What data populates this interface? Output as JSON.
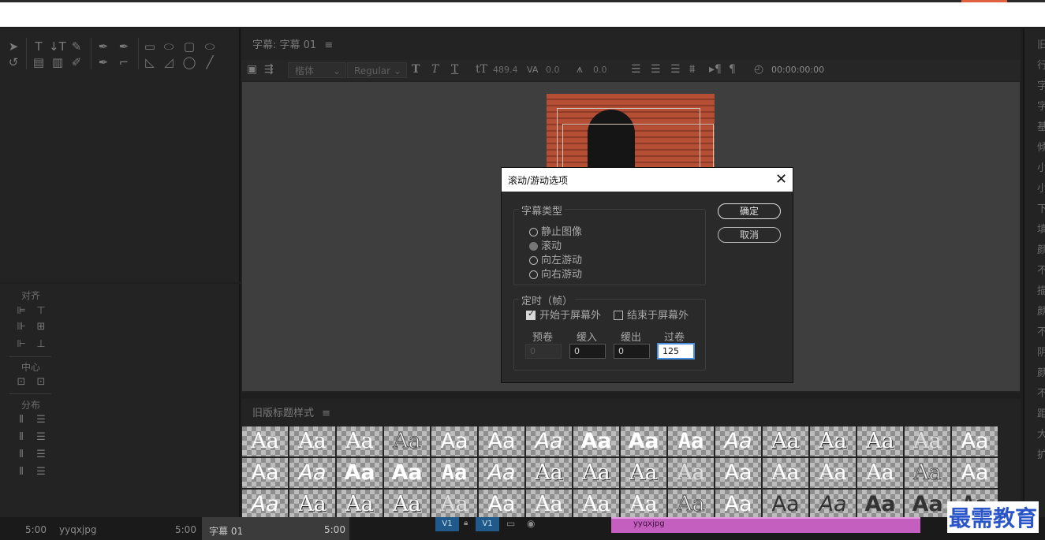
{
  "editor": {
    "tab_label": "字幕: 字幕 01",
    "menu_icon": "≡",
    "font_family": "楷体",
    "font_style": "Regular",
    "font_size": "489.4",
    "kerning": "0.0",
    "leading": "0.0",
    "timecode": "00:00:00:00"
  },
  "align_panel": {
    "align_label": "对齐",
    "center_label": "中心",
    "distribute_label": "分布"
  },
  "styles_panel": {
    "label": "旧版标题样式",
    "menu_icon": "≡",
    "swatch_text": "Aa"
  },
  "dialog": {
    "title": "滚动/游动选项",
    "close_icon": "✕",
    "type_group_label": "字幕类型",
    "options": [
      {
        "label": "静止图像",
        "selected": false
      },
      {
        "label": "滚动",
        "selected": true
      },
      {
        "label": "向左游动",
        "selected": false
      },
      {
        "label": "向右游动",
        "selected": false
      }
    ],
    "timing_group_label": "定时（帧）",
    "start_offscreen": {
      "label": "开始于屏幕外",
      "checked": true
    },
    "end_offscreen": {
      "label": "结束于屏幕外",
      "checked": false
    },
    "fields": {
      "preroll": {
        "label": "预卷",
        "value": "0"
      },
      "ease_in": {
        "label": "缓入",
        "value": "0"
      },
      "ease_out": {
        "label": "缓出",
        "value": "0"
      },
      "postroll": {
        "label": "过卷",
        "value": "125"
      }
    },
    "ok_label": "确定",
    "cancel_label": "取消"
  },
  "right_panel": {
    "chars": [
      "旧",
      "行",
      "字",
      "字",
      "基",
      "倾",
      "小",
      "小",
      "下",
      "填",
      "颜",
      "不",
      "描",
      "颜",
      "不",
      "阴",
      "颜",
      "不",
      "距",
      "大",
      "扩"
    ]
  },
  "bottom": {
    "time_left": "5:00",
    "project_item": "yyqxjpg",
    "project_item_time": "5:00",
    "tab_label": "字幕 01",
    "tab_time": "5:00",
    "track_v1_a": "V1",
    "track_v1_b": "V1",
    "clip_label": "yyqxjpg"
  },
  "watermark": "最需教育",
  "colors": {
    "clip": "#c45fc0",
    "track": "#1f5a8a",
    "watermark": "#2a55c8"
  }
}
